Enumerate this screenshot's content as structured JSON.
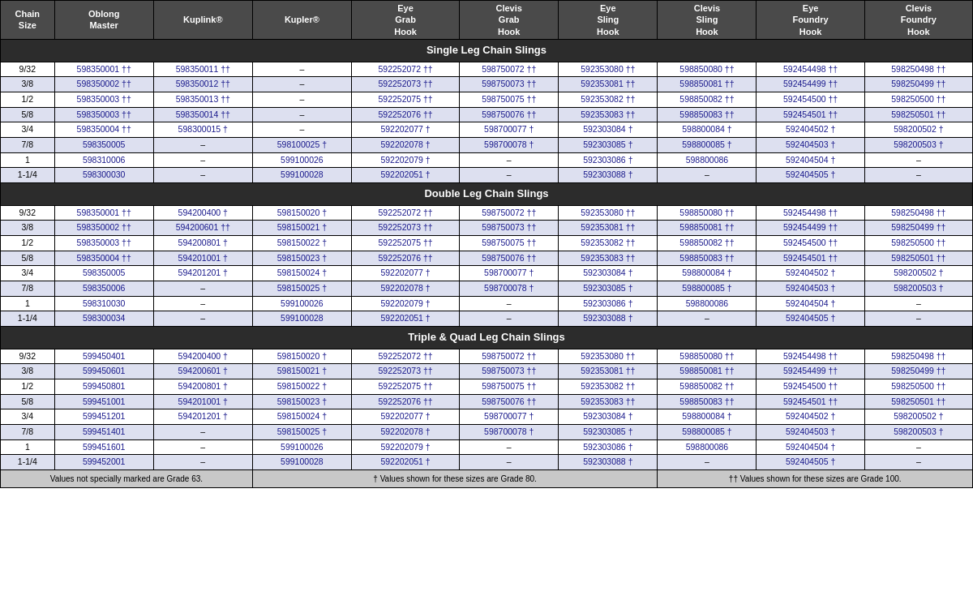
{
  "headers": {
    "chain_size": "Chain\nSize",
    "oblong_master": "Oblong\nMaster",
    "kuplink": "Kuplink®",
    "kupler": "Kupler®",
    "eye_grab_hook": "Eye\nGrab\nHook",
    "clevis_grab_hook": "Clevis\nGrab\nHook",
    "eye_sling_hook": "Eye\nSling\nHook",
    "clevis_sling_hook": "Clevis\nSling\nHook",
    "eye_foundry_hook": "Eye\nFoundry\nHook",
    "clevis_foundry_hook": "Clevis\nFoundry\nHook"
  },
  "sections": [
    {
      "title": "Single Leg Chain Slings",
      "rows": [
        {
          "size": "9/32",
          "oblong": "598350001 ††",
          "kuplink": "598350011 ††",
          "kupler": "–",
          "eye_grab": "592252072 ††",
          "clevis_grab": "598750072 ††",
          "eye_sling": "592353080 ††",
          "clevis_sling": "598850080 ††",
          "eye_foundry": "592454498 ††",
          "clevis_foundry": "598250498 ††"
        },
        {
          "size": "3/8",
          "oblong": "598350002 ††",
          "kuplink": "598350012 ††",
          "kupler": "–",
          "eye_grab": "592252073 ††",
          "clevis_grab": "598750073 ††",
          "eye_sling": "592353081 ††",
          "clevis_sling": "598850081 ††",
          "eye_foundry": "592454499 ††",
          "clevis_foundry": "598250499 ††"
        },
        {
          "size": "1/2",
          "oblong": "598350003 ††",
          "kuplink": "598350013 ††",
          "kupler": "–",
          "eye_grab": "592252075 ††",
          "clevis_grab": "598750075 ††",
          "eye_sling": "592353082 ††",
          "clevis_sling": "598850082 ††",
          "eye_foundry": "592454500 ††",
          "clevis_foundry": "598250500 ††"
        },
        {
          "size": "5/8",
          "oblong": "598350003 ††",
          "kuplink": "598350014 ††",
          "kupler": "–",
          "eye_grab": "592252076 ††",
          "clevis_grab": "598750076 ††",
          "eye_sling": "592353083 ††",
          "clevis_sling": "598850083 ††",
          "eye_foundry": "592454501 ††",
          "clevis_foundry": "598250501 ††"
        },
        {
          "size": "3/4",
          "oblong": "598350004 ††",
          "kuplink": "598300015 †",
          "kupler": "–",
          "eye_grab": "592202077 †",
          "clevis_grab": "598700077 †",
          "eye_sling": "592303084 †",
          "clevis_sling": "598800084 †",
          "eye_foundry": "592404502 †",
          "clevis_foundry": "598200502 †"
        },
        {
          "size": "7/8",
          "oblong": "598350005",
          "kuplink": "–",
          "kupler": "598100025 †",
          "eye_grab": "592202078 †",
          "clevis_grab": "598700078 †",
          "eye_sling": "592303085 †",
          "clevis_sling": "598800085 †",
          "eye_foundry": "592404503 †",
          "clevis_foundry": "598200503 †"
        },
        {
          "size": "1",
          "oblong": "598310006",
          "kuplink": "–",
          "kupler": "599100026",
          "eye_grab": "592202079 †",
          "clevis_grab": "–",
          "eye_sling": "592303086 †",
          "clevis_sling": "598800086",
          "eye_foundry": "592404504 †",
          "clevis_foundry": "–"
        },
        {
          "size": "1-1/4",
          "oblong": "598300030",
          "kuplink": "–",
          "kupler": "599100028",
          "eye_grab": "592202051 †",
          "clevis_grab": "–",
          "eye_sling": "592303088 †",
          "clevis_sling": "–",
          "eye_foundry": "592404505 †",
          "clevis_foundry": "–"
        }
      ]
    },
    {
      "title": "Double Leg Chain Slings",
      "rows": [
        {
          "size": "9/32",
          "oblong": "598350001 ††",
          "kuplink": "594200400 †",
          "kupler": "598150020 †",
          "eye_grab": "592252072 ††",
          "clevis_grab": "598750072 ††",
          "eye_sling": "592353080 ††",
          "clevis_sling": "598850080 ††",
          "eye_foundry": "592454498 ††",
          "clevis_foundry": "598250498 ††"
        },
        {
          "size": "3/8",
          "oblong": "598350002 ††",
          "kuplink": "594200601 ††",
          "kupler": "598150021 †",
          "eye_grab": "592252073 ††",
          "clevis_grab": "598750073 ††",
          "eye_sling": "592353081 ††",
          "clevis_sling": "598850081 ††",
          "eye_foundry": "592454499 ††",
          "clevis_foundry": "598250499 ††"
        },
        {
          "size": "1/2",
          "oblong": "598350003 ††",
          "kuplink": "594200801 †",
          "kupler": "598150022 †",
          "eye_grab": "592252075 ††",
          "clevis_grab": "598750075 ††",
          "eye_sling": "592353082 ††",
          "clevis_sling": "598850082 ††",
          "eye_foundry": "592454500 ††",
          "clevis_foundry": "598250500 ††"
        },
        {
          "size": "5/8",
          "oblong": "598350004 ††",
          "kuplink": "594201001 †",
          "kupler": "598150023 †",
          "eye_grab": "592252076 ††",
          "clevis_grab": "598750076 ††",
          "eye_sling": "592353083 ††",
          "clevis_sling": "598850083 ††",
          "eye_foundry": "592454501 ††",
          "clevis_foundry": "598250501 ††"
        },
        {
          "size": "3/4",
          "oblong": "598350005",
          "kuplink": "594201201 †",
          "kupler": "598150024 †",
          "eye_grab": "592202077 †",
          "clevis_grab": "598700077 †",
          "eye_sling": "592303084 †",
          "clevis_sling": "598800084 †",
          "eye_foundry": "592404502 †",
          "clevis_foundry": "598200502 †"
        },
        {
          "size": "7/8",
          "oblong": "598350006",
          "kuplink": "–",
          "kupler": "598150025 †",
          "eye_grab": "592202078 †",
          "clevis_grab": "598700078 †",
          "eye_sling": "592303085 †",
          "clevis_sling": "598800085 †",
          "eye_foundry": "592404503 †",
          "clevis_foundry": "598200503 †"
        },
        {
          "size": "1",
          "oblong": "598310030",
          "kuplink": "–",
          "kupler": "599100026",
          "eye_grab": "592202079 †",
          "clevis_grab": "–",
          "eye_sling": "592303086 †",
          "clevis_sling": "598800086",
          "eye_foundry": "592404504 †",
          "clevis_foundry": "–"
        },
        {
          "size": "1-1/4",
          "oblong": "598300034",
          "kuplink": "–",
          "kupler": "599100028",
          "eye_grab": "592202051 †",
          "clevis_grab": "–",
          "eye_sling": "592303088 †",
          "clevis_sling": "–",
          "eye_foundry": "592404505 †",
          "clevis_foundry": "–"
        }
      ]
    },
    {
      "title": "Triple & Quad Leg Chain Slings",
      "rows": [
        {
          "size": "9/32",
          "oblong": "599450401",
          "kuplink": "594200400 †",
          "kupler": "598150020 †",
          "eye_grab": "592252072 ††",
          "clevis_grab": "598750072 ††",
          "eye_sling": "592353080 ††",
          "clevis_sling": "598850080 ††",
          "eye_foundry": "592454498 ††",
          "clevis_foundry": "598250498 ††"
        },
        {
          "size": "3/8",
          "oblong": "599450601",
          "kuplink": "594200601 †",
          "kupler": "598150021 †",
          "eye_grab": "592252073 ††",
          "clevis_grab": "598750073 ††",
          "eye_sling": "592353081 ††",
          "clevis_sling": "598850081 ††",
          "eye_foundry": "592454499 ††",
          "clevis_foundry": "598250499 ††"
        },
        {
          "size": "1/2",
          "oblong": "599450801",
          "kuplink": "594200801 †",
          "kupler": "598150022 †",
          "eye_grab": "592252075 ††",
          "clevis_grab": "598750075 ††",
          "eye_sling": "592353082 ††",
          "clevis_sling": "598850082 ††",
          "eye_foundry": "592454500 ††",
          "clevis_foundry": "598250500 ††"
        },
        {
          "size": "5/8",
          "oblong": "599451001",
          "kuplink": "594201001 †",
          "kupler": "598150023 †",
          "eye_grab": "592252076 ††",
          "clevis_grab": "598750076 ††",
          "eye_sling": "592353083 ††",
          "clevis_sling": "598850083 ††",
          "eye_foundry": "592454501 ††",
          "clevis_foundry": "598250501 ††"
        },
        {
          "size": "3/4",
          "oblong": "599451201",
          "kuplink": "594201201 †",
          "kupler": "598150024 †",
          "eye_grab": "592202077 †",
          "clevis_grab": "598700077 †",
          "eye_sling": "592303084 †",
          "clevis_sling": "598800084 †",
          "eye_foundry": "592404502 †",
          "clevis_foundry": "598200502 †"
        },
        {
          "size": "7/8",
          "oblong": "599451401",
          "kuplink": "–",
          "kupler": "598150025 †",
          "eye_grab": "592202078 †",
          "clevis_grab": "598700078 †",
          "eye_sling": "592303085 †",
          "clevis_sling": "598800085 †",
          "eye_foundry": "592404503 †",
          "clevis_foundry": "598200503 †"
        },
        {
          "size": "1",
          "oblong": "599451601",
          "kuplink": "–",
          "kupler": "599100026",
          "eye_grab": "592202079 †",
          "clevis_grab": "–",
          "eye_sling": "592303086 †",
          "clevis_sling": "598800086",
          "eye_foundry": "592404504 †",
          "clevis_foundry": "–"
        },
        {
          "size": "1-1/4",
          "oblong": "599452001",
          "kuplink": "–",
          "kupler": "599100028",
          "eye_grab": "592202051 †",
          "clevis_grab": "–",
          "eye_sling": "592303088 †",
          "clevis_sling": "–",
          "eye_foundry": "592404505 †",
          "clevis_foundry": "–"
        }
      ]
    }
  ],
  "footer": {
    "col1": "Values not specially marked are Grade 63.",
    "col2": "† Values shown for these sizes are Grade 80.",
    "col3": "†† Values shown for these sizes are Grade 100."
  }
}
